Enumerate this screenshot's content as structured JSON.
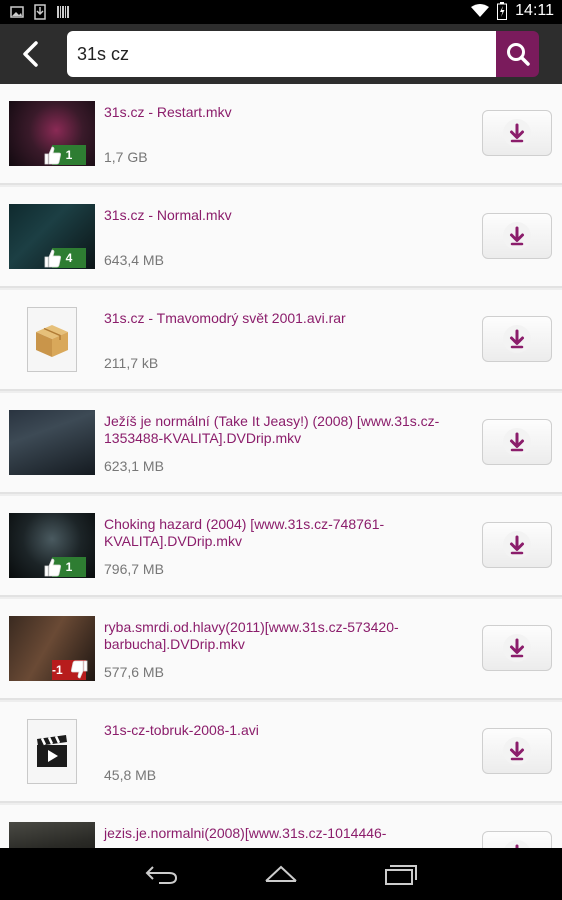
{
  "status_bar": {
    "time": "14:11"
  },
  "search": {
    "query": "31s cz"
  },
  "results": [
    {
      "name": "31s.cz - Restart.mkv",
      "size": "1,7 GB",
      "thumb": "video",
      "likes": "1"
    },
    {
      "name": "31s.cz - Normal.mkv",
      "size": "643,4 MB",
      "thumb": "video",
      "likes": "4"
    },
    {
      "name": "31s.cz - Tmavomodrý svět 2001.avi.rar",
      "size": "211,7 kB",
      "thumb": "archive"
    },
    {
      "name": "Ježíš je normální (Take It Jeasy!) (2008) [www.31s.cz-1353488-KVALITA].DVDrip.mkv",
      "size": "623,1 MB",
      "thumb": "video"
    },
    {
      "name": "Choking hazard (2004) [www.31s.cz-748761-KVALITA].DVDrip.mkv",
      "size": "796,7 MB",
      "thumb": "video",
      "likes": "1"
    },
    {
      "name": "ryba.smrdi.od.hlavy(2011)[www.31s.cz-573420-barbucha].DVDrip.mkv",
      "size": "577,6 MB",
      "thumb": "video",
      "likes": "-1"
    },
    {
      "name": "31s-cz-tobruk-2008-1.avi",
      "size": "45,8 MB",
      "thumb": "movie"
    },
    {
      "name": "jezis.je.normalni(2008)[www.31s.cz-1014446-",
      "size": "",
      "thumb": "video"
    }
  ]
}
